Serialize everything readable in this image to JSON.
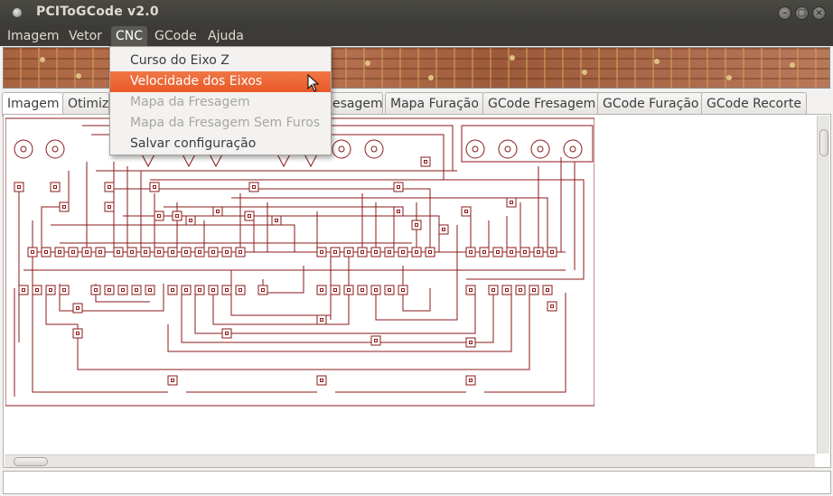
{
  "window": {
    "title": "PCIToGCode  v2.0",
    "controls": {
      "minimize": "–",
      "maximize": "□",
      "close": "×"
    }
  },
  "menubar": {
    "items": [
      {
        "label": "Imagem"
      },
      {
        "label": "Vetor"
      },
      {
        "label": "CNC",
        "active": true
      },
      {
        "label": "GCode"
      },
      {
        "label": "Ajuda"
      }
    ]
  },
  "tabs": [
    {
      "label": "Imagem",
      "active": true
    },
    {
      "label": "Otimiz"
    },
    {
      "label": "esagem"
    },
    {
      "label": "Mapa Furação"
    },
    {
      "label": "GCode Fresagem"
    },
    {
      "label": "GCode Furação"
    },
    {
      "label": "GCode Recorte"
    }
  ],
  "cnc_menu": {
    "items": [
      {
        "label": "Curso do Eixo Z",
        "state": "normal"
      },
      {
        "label": "Velocidade dos Eixos",
        "state": "highlighted"
      },
      {
        "label": "Mapa da Fresagem",
        "state": "disabled"
      },
      {
        "label": "Mapa da Fresagem Sem Furos",
        "state": "disabled"
      },
      {
        "label": "Salvar configuração",
        "state": "normal"
      }
    ]
  },
  "colors": {
    "trace": "#8b1a1a",
    "menu_highlight": "#e95a27",
    "titlebar": "#3c3b37"
  },
  "icons": {
    "app": "app-icon",
    "cursor": "mouse-pointer-icon"
  }
}
